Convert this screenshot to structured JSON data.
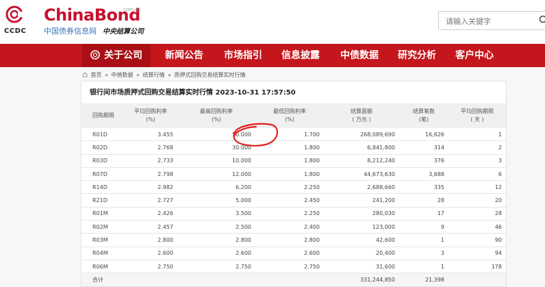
{
  "header": {
    "ccdc_logo_text": "CCDC",
    "brand_word": "ChinaBond",
    "brand_domain": "com.cn",
    "brand_subtitle": "中国债券信息网",
    "brand_seal": "中央结算公司",
    "search_placeholder": "请输入关键字"
  },
  "nav": {
    "items": [
      {
        "label": "关于公司",
        "active": true
      },
      {
        "label": "新闻公告"
      },
      {
        "label": "市场指引"
      },
      {
        "label": "信息披露"
      },
      {
        "label": "中债数据"
      },
      {
        "label": "研究分析"
      },
      {
        "label": "客户中心"
      }
    ]
  },
  "breadcrumb": {
    "items": [
      "首页",
      "»",
      "中债数据",
      "»",
      "结算行情",
      "»",
      "质押式回购交易结算实时行情"
    ]
  },
  "panel": {
    "title": "银行间市场质押式回购交易结算实时行情 2023-10-31 17:57:50"
  },
  "table": {
    "headers": [
      {
        "l1": "回购期限",
        "l2": ""
      },
      {
        "l1": "平均回购利率",
        "l2": "(%)"
      },
      {
        "l1": "最高回购利率",
        "l2": "(%)"
      },
      {
        "l1": "最低回购利率",
        "l2": "(%)"
      },
      {
        "l1": "结算面额",
        "l2": "( 万元 )"
      },
      {
        "l1": "结算笔数",
        "l2": "(笔)"
      },
      {
        "l1": "平均回购期限",
        "l2": "( 天 )"
      }
    ],
    "rows": [
      [
        "R01D",
        "3.455",
        "50.000",
        "1.700",
        "268,089,690",
        "16,626",
        "1"
      ],
      [
        "R02D",
        "2.768",
        "30.000",
        "1.800",
        "6,841,800",
        "314",
        "2"
      ],
      [
        "R03D",
        "2.733",
        "10.000",
        "1.800",
        "8,212,240",
        "376",
        "3"
      ],
      [
        "R07D",
        "2.798",
        "12.000",
        "1.800",
        "44,673,630",
        "3,688",
        "6"
      ],
      [
        "R14D",
        "2.982",
        "6.200",
        "2.250",
        "2,688,660",
        "335",
        "12"
      ],
      [
        "R21D",
        "2.727",
        "5.000",
        "2.450",
        "241,200",
        "28",
        "20"
      ],
      [
        "R01M",
        "2.426",
        "3.500",
        "2.250",
        "280,030",
        "17",
        "28"
      ],
      [
        "R02M",
        "2.457",
        "2.500",
        "2.400",
        "123,000",
        "9",
        "46"
      ],
      [
        "R03M",
        "2.800",
        "2.800",
        "2.800",
        "42,600",
        "1",
        "90"
      ],
      [
        "R04M",
        "2.600",
        "2.600",
        "2.600",
        "20,400",
        "3",
        "94"
      ],
      [
        "R06M",
        "2.750",
        "2.750",
        "2.750",
        "31,600",
        "1",
        "178"
      ]
    ],
    "total": [
      "合计",
      "",
      "",
      "",
      "331,244,850",
      "21,398",
      ""
    ]
  },
  "colors": {
    "brand_red": "#c4161c",
    "link_blue": "#3a74b8",
    "annotation_red": "#e0201f"
  }
}
